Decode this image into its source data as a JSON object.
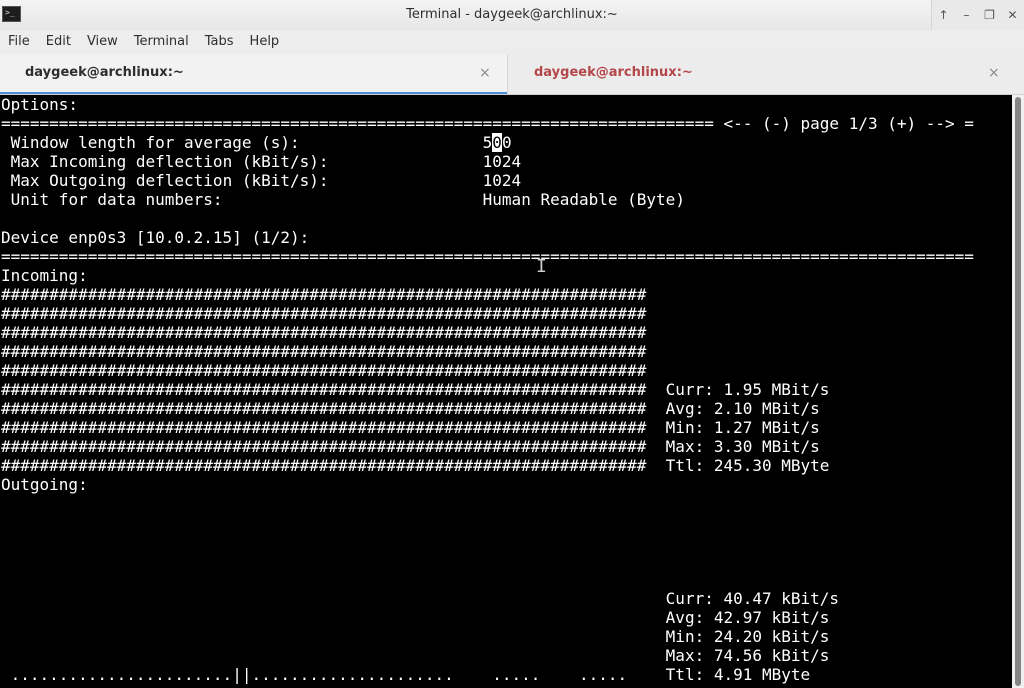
{
  "window": {
    "title": "Terminal - daygeek@archlinux:~",
    "app_icon_glyph": ">_",
    "controls": [
      {
        "name": "up-arrow",
        "glyph": "↑"
      },
      {
        "name": "minimize",
        "glyph": "–"
      },
      {
        "name": "maximize",
        "glyph": "❐"
      },
      {
        "name": "close",
        "glyph": "✕"
      }
    ]
  },
  "menu": [
    "File",
    "Edit",
    "View",
    "Terminal",
    "Tabs",
    "Help"
  ],
  "tabs": [
    {
      "label": "daygeek@archlinux:~",
      "close": "×",
      "active": true
    },
    {
      "label": "daygeek@archlinux:~",
      "close": "×",
      "active": false
    }
  ],
  "colors": {
    "accent": "#4a90d9",
    "inactive_tab_text": "#b3474a"
  },
  "terminal": {
    "options_header": "Options:",
    "page_nav": "<-- (-) page 1/3 (+) -->",
    "options": [
      {
        "label": "Window length for average (s):",
        "value": "500"
      },
      {
        "label": "Max Incoming deflection (kBit/s):",
        "value": "1024"
      },
      {
        "label": "Max Outgoing deflection (kBit/s):",
        "value": "1024"
      },
      {
        "label": "Unit for data numbers:",
        "value": "Human Readable (Byte)"
      }
    ],
    "device_header": "Device enp0s3 [10.0.2.15] (1/2):",
    "incoming_label": "Incoming:",
    "incoming_stats": [
      "Curr: 1.95 MBit/s",
      "Avg: 2.10 MBit/s",
      "Min: 1.27 MBit/s",
      "Max: 3.30 MBit/s",
      "Ttl: 245.30 MByte"
    ],
    "outgoing_label": "Outgoing:",
    "outgoing_stats": [
      "Curr: 40.47 kBit/s",
      "Avg: 42.97 kBit/s",
      "Min: 24.20 kBit/s",
      "Max: 74.56 kBit/s",
      "Ttl: 4.91 MByte"
    ],
    "bar_glyph": "#",
    "bar_width_chars": 67,
    "incoming_bar_rows": 10,
    "outgoing_graph_line": " .......................||.....................    .....    ....."
  }
}
